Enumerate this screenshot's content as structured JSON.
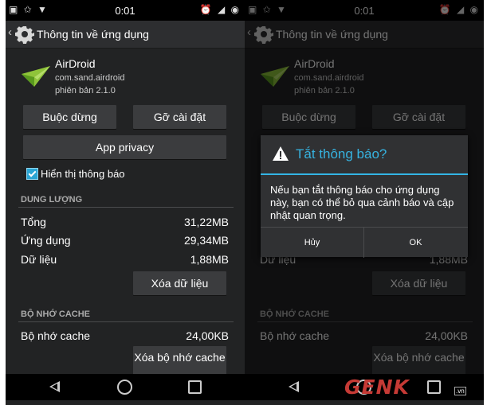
{
  "status": {
    "time": "0:01"
  },
  "header": {
    "title": "Thông tin về ứng dụng"
  },
  "app": {
    "name": "AirDroid",
    "package": "com.sand.airdroid",
    "version": "phiên bản 2.1.0"
  },
  "buttons": {
    "force_stop": "Buộc dừng",
    "uninstall": "Gỡ cài đặt",
    "app_privacy": "App privacy",
    "clear_data": "Xóa dữ liệu",
    "clear_cache": "Xóa bộ nhớ cache"
  },
  "notifications": {
    "label": "Hiển thị thông báo",
    "checked": true
  },
  "storage": {
    "header": "DUNG LƯỢNG",
    "rows": [
      {
        "label": "Tổng",
        "value": "31,22MB"
      },
      {
        "label": "Ứng dụng",
        "value": "29,34MB"
      },
      {
        "label": "Dữ liệu",
        "value": "1,88MB"
      }
    ]
  },
  "cache": {
    "header": "BỘ NHỚ CACHE",
    "label": "Bộ nhớ cache",
    "value": "24,00KB"
  },
  "dialog": {
    "title": "Tắt thông báo?",
    "body": "Nếu bạn tắt thông báo cho ứng dụng này, bạn có thể bỏ qua cảnh báo và cập nhật quan trọng.",
    "cancel": "Hủy",
    "ok": "OK"
  },
  "watermark": {
    "text": "GENK",
    "suffix": ".vn"
  },
  "colors": {
    "accent": "#33b5e5",
    "background": "#222324",
    "checkbox": "#2aa5d4"
  },
  "icons": [
    "gear-icon",
    "airdroid-icon",
    "warning-icon",
    "wifi-icon",
    "battery-icon",
    "nav-back-icon",
    "nav-home-icon",
    "nav-recents-icon"
  ]
}
